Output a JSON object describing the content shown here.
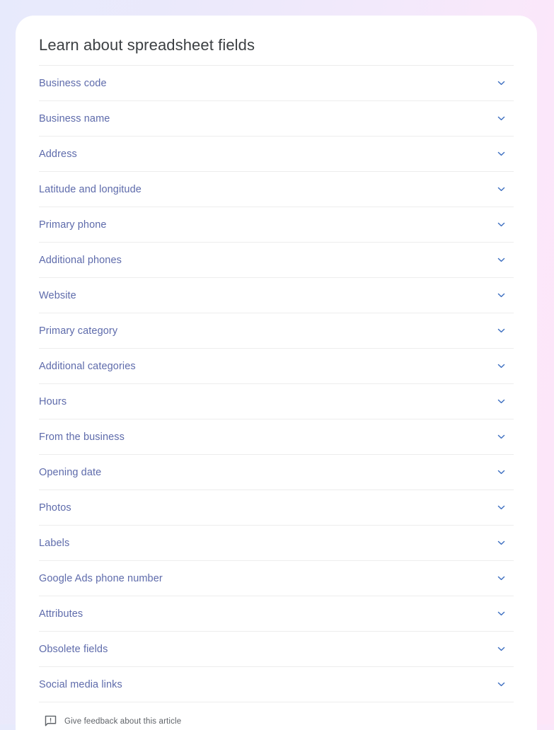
{
  "page": {
    "background_gradient_start": "#e7eafc",
    "background_gradient_end": "#fde6f8",
    "card_background": "#ffffff"
  },
  "article": {
    "title": "Learn about spreadsheet fields",
    "title_color": "#3c4043",
    "link_color": "#5e6bab",
    "divider_color": "#ededed",
    "chevron_color": "#3c6ec0",
    "chevron_icon": "chevron-down-icon"
  },
  "accordion": {
    "items": [
      {
        "label": "Business code"
      },
      {
        "label": "Business name"
      },
      {
        "label": "Address"
      },
      {
        "label": "Latitude and longitude"
      },
      {
        "label": "Primary phone"
      },
      {
        "label": "Additional phones"
      },
      {
        "label": "Website"
      },
      {
        "label": "Primary category"
      },
      {
        "label": "Additional categories"
      },
      {
        "label": "Hours"
      },
      {
        "label": "From the business"
      },
      {
        "label": "Opening date"
      },
      {
        "label": "Photos"
      },
      {
        "label": "Labels"
      },
      {
        "label": "Google Ads phone number"
      },
      {
        "label": "Attributes"
      },
      {
        "label": "Obsolete fields"
      },
      {
        "label": "Social media links"
      }
    ]
  },
  "feedback": {
    "label": "Give feedback about this article",
    "icon": "feedback-bubble-icon",
    "text_color": "#5f6368"
  }
}
